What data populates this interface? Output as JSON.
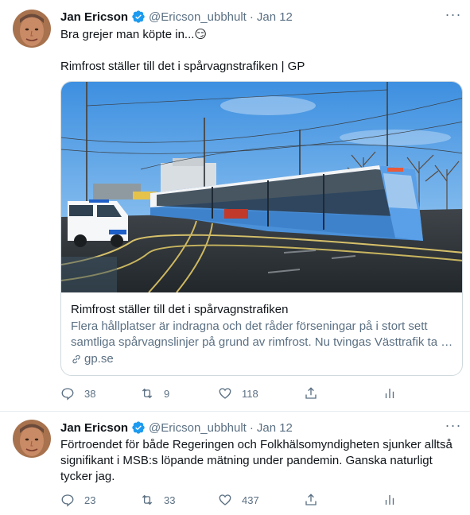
{
  "tweets": [
    {
      "name": "Jan Ericson",
      "handle": "@Ericson_ubbhult",
      "dot": "·",
      "date": "Jan 12",
      "line1": "Bra grejer man köpte in...😏",
      "line2": "Rimfrost ställer till det i spårvagnstrafiken | GP",
      "card": {
        "title": "Rimfrost ställer till det i spårvagnstrafiken",
        "description": "Flera hållplatser är indragna och det råder förseningar på i stort sett samtliga spårvagnslinjer på grund av rimfrost. Nu tvingas Västtrafik ta …",
        "domain": "gp.se"
      },
      "replies": "38",
      "retweets": "9",
      "likes": "118"
    },
    {
      "name": "Jan Ericson",
      "handle": "@Ericson_ubbhult",
      "dot": "·",
      "date": "Jan 12",
      "text": "Förtroendet för både Regeringen och Folkhälsomyndigheten sjunker alltså signifikant i MSB:s löpande mätning under pandemin. Ganska naturligt tycker jag.",
      "replies": "23",
      "retweets": "33",
      "likes": "437"
    }
  ],
  "icons": {
    "verified": "verified-badge-icon",
    "more": "more-icon",
    "reply": "reply-icon",
    "retweet": "retweet-icon",
    "like": "heart-icon",
    "share": "share-icon",
    "analytics": "analytics-icon",
    "link": "link-icon"
  },
  "colors": {
    "text": "#0f1419",
    "secondary": "#5b7083",
    "verified": "#1d9bf0",
    "border": "#cfd9de",
    "tram": "#4a90d9"
  },
  "more_glyph": "···"
}
